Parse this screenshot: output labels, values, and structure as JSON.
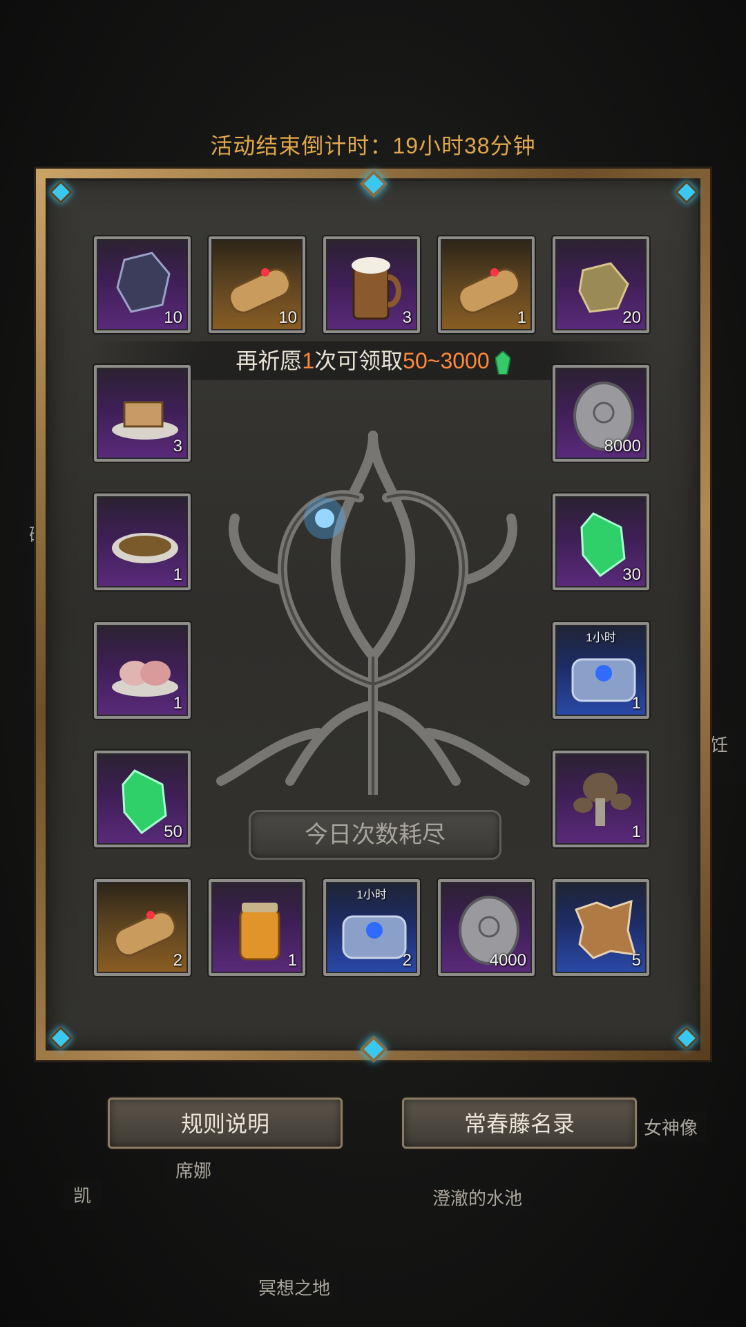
{
  "countdown": {
    "label": "活动结束倒计时：",
    "value": "19小时38分钟"
  },
  "progress": {
    "prefix": "再祈愿",
    "times": "1",
    "middle": "次可领取",
    "range": "50~3000"
  },
  "status_button": "今日次数耗尽",
  "buttons": {
    "rules": "规则说明",
    "roster": "常春藤名录"
  },
  "background_labels": [
    "矿",
    "烹饪锅",
    "女神像",
    "席娜",
    "凯",
    "澄澈的水池",
    "冥想之地"
  ],
  "slots": {
    "top": [
      {
        "item": "ore-icon",
        "count": "10",
        "rarity": "purple"
      },
      {
        "item": "scroll-icon",
        "count": "10",
        "rarity": "gold"
      },
      {
        "item": "ale-mug-icon",
        "count": "3",
        "rarity": "purple"
      },
      {
        "item": "scroll-icon",
        "count": "1",
        "rarity": "gold"
      },
      {
        "item": "amber-stone-icon",
        "count": "20",
        "rarity": "purple"
      }
    ],
    "left": [
      {
        "item": "bread-icon",
        "count": "3",
        "rarity": "purple"
      },
      {
        "item": "stew-icon",
        "count": "1",
        "rarity": "purple"
      },
      {
        "item": "fish-fillet-icon",
        "count": "1",
        "rarity": "purple"
      },
      {
        "item": "emerald-icon",
        "count": "50",
        "rarity": "purple"
      }
    ],
    "right": [
      {
        "item": "silver-coin-icon",
        "count": "8000",
        "rarity": "purple"
      },
      {
        "item": "emerald-icon",
        "count": "30",
        "rarity": "purple"
      },
      {
        "item": "blue-chest-icon",
        "count": "1",
        "rarity": "blue",
        "timer": "1小时"
      },
      {
        "item": "mushroom-icon",
        "count": "1",
        "rarity": "purple"
      }
    ],
    "bottom": [
      {
        "item": "scroll-icon",
        "count": "2",
        "rarity": "gold"
      },
      {
        "item": "honey-jar-icon",
        "count": "1",
        "rarity": "purple"
      },
      {
        "item": "blue-chest-icon",
        "count": "2",
        "rarity": "blue",
        "timer": "1小时"
      },
      {
        "item": "silver-coin-icon",
        "count": "4000",
        "rarity": "purple"
      },
      {
        "item": "hide-icon",
        "count": "5",
        "rarity": "blue"
      }
    ]
  }
}
